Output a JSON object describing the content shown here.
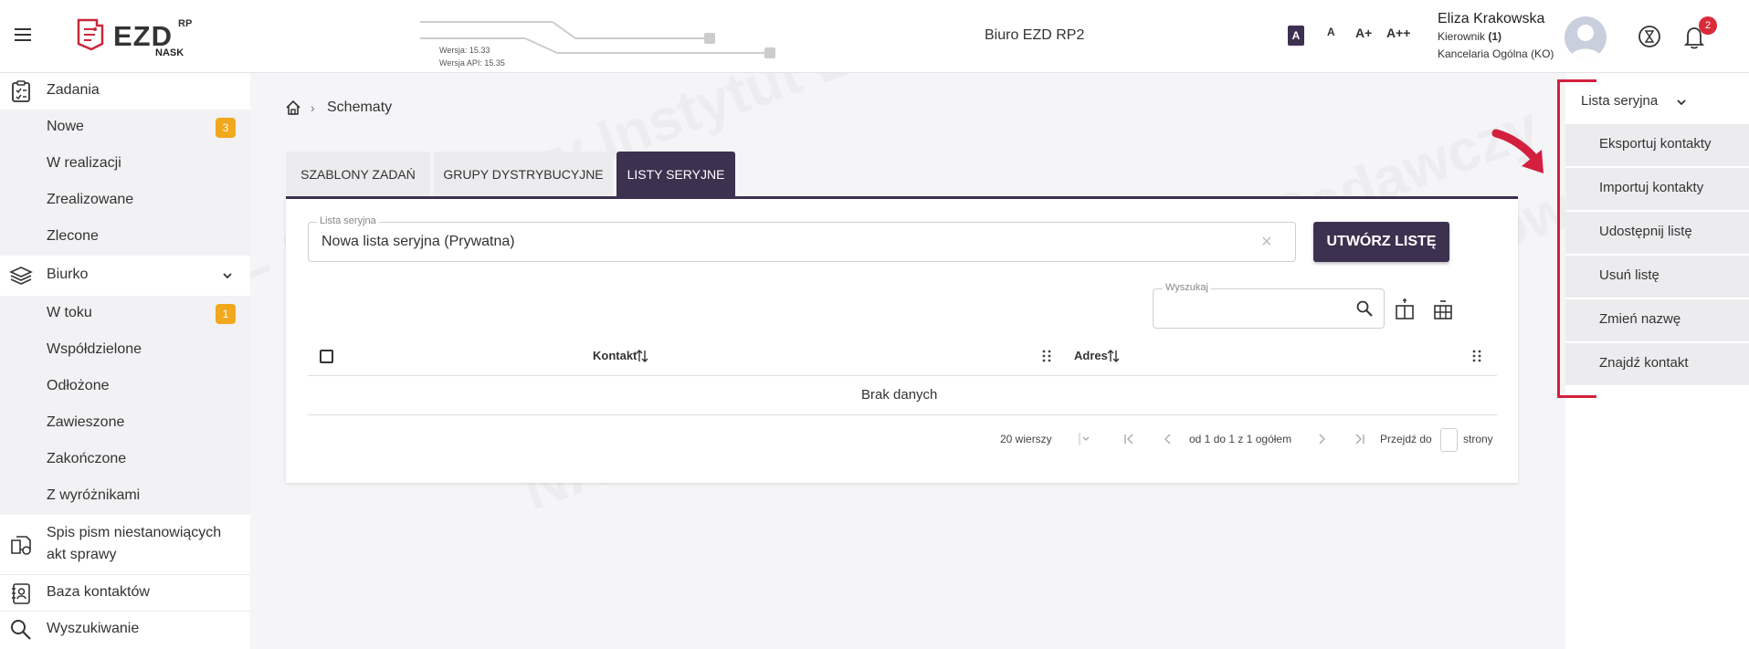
{
  "header": {
    "logo_text": "EZD",
    "logo_superscript": "RP",
    "logo_org": "NASK",
    "version": "Wersja: 15.33",
    "api_version": "Wersja API: 15.35",
    "office": "Biuro EZD RP2",
    "font_sizes": [
      "A",
      "A",
      "A+",
      "A++"
    ],
    "user": {
      "name": "Eliza Krakowska",
      "role_prefix": "Kierownik ",
      "role_count": "(1)",
      "unit": "Kancelaria Ogólna (KO)"
    },
    "notifications_count": "2"
  },
  "sidebar": {
    "zadania": "Zadania",
    "zadania_items": [
      {
        "label": "Nowe",
        "badge": "3"
      },
      {
        "label": "W realizacji"
      },
      {
        "label": "Zrealizowane"
      },
      {
        "label": "Zlecone"
      }
    ],
    "biurko": "Biurko",
    "biurko_items": [
      {
        "label": "W toku",
        "badge": "1"
      },
      {
        "label": "Współdzielone"
      },
      {
        "label": "Odłożone"
      },
      {
        "label": "Zawieszone"
      },
      {
        "label": "Zakończone"
      },
      {
        "label": "Z wyróżnikami"
      }
    ],
    "spis_line1": "Spis pism niestanowiących",
    "spis_line2": "akt sprawy",
    "baza": "Baza kontaktów",
    "wyszukiwanie": "Wyszukiwanie"
  },
  "breadcrumb": {
    "current": "Schematy"
  },
  "tabs": [
    {
      "label": "SZABLONY ZADAŃ"
    },
    {
      "label": "GRUPY DYSTRYBUCYJNE"
    },
    {
      "label": "LISTY SERYJNE",
      "active": true
    }
  ],
  "list_field": {
    "label": "Lista seryjna",
    "value": "Nowa lista seryjna (Prywatna)"
  },
  "create_button": "UTWÓRZ LISTĘ",
  "search": {
    "label": "Wyszukaj"
  },
  "table": {
    "columns": [
      "Kontakt",
      "Adres"
    ],
    "empty_text": "Brak danych"
  },
  "pagination": {
    "rows": "20 wierszy",
    "range": "od 1 do 1 z 1 ogółem",
    "goto_prefix": "Przejdź do",
    "goto_suffix": "strony"
  },
  "menu": {
    "title": "Lista seryjna",
    "items": [
      "Eksportuj kontakty",
      "Importuj kontakty",
      "Udostępnij listę",
      "Usuń listę",
      "Zmień nazwę",
      "Znajdź kontakt"
    ]
  },
  "colors": {
    "primary": "#3d3150",
    "badge": "#f1a81d",
    "highlight": "#d3203e",
    "notification": "#d92b3a"
  },
  "watermark": "NASK – Państwowy Instytut Badawczy"
}
